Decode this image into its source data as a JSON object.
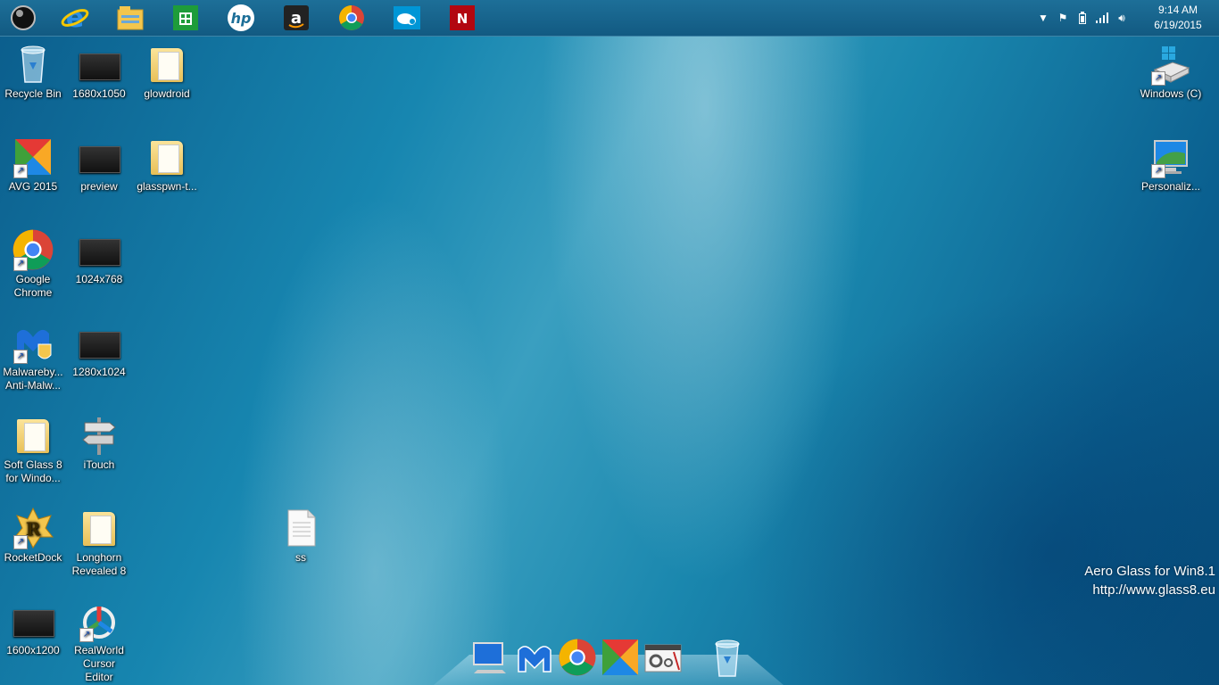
{
  "taskbar": {
    "pinned": [
      {
        "id": "start",
        "icon": "start-orb-icon",
        "color": "#111111"
      },
      {
        "id": "ie",
        "icon": "internet-explorer-icon",
        "color": "#1e88e5"
      },
      {
        "id": "explorer",
        "icon": "file-explorer-icon",
        "color": "#f3c64d"
      },
      {
        "id": "store",
        "icon": "windows-store-icon",
        "color": "#1e9c3a"
      },
      {
        "id": "hp",
        "icon": "hp-logo-icon",
        "color": "#0096d6",
        "text": "hp"
      },
      {
        "id": "amazon",
        "icon": "amazon-icon",
        "color": "#222222",
        "text": "a"
      },
      {
        "id": "chrome",
        "icon": "chrome-icon",
        "color": "#db4437"
      },
      {
        "id": "hp-connected",
        "icon": "hp-cloud-icon",
        "color": "#0096d6"
      },
      {
        "id": "netflix",
        "icon": "netflix-icon",
        "color": "#b20710",
        "text": "N"
      }
    ],
    "tray": {
      "icons": [
        "chevron-up-icon",
        "action-center-flag-icon",
        "battery-icon",
        "signal-bars-icon",
        "volume-icon"
      ],
      "time": "9:14 AM",
      "date": "6/19/2015"
    }
  },
  "desktop": {
    "recycle_bin": "Recycle Bin",
    "res_1680": "1680x1050",
    "glowdroid": "glowdroid",
    "avg": "AVG 2015",
    "preview": "preview",
    "glasspwn": "glasspwn-t...",
    "chrome_line1": "Google",
    "chrome_line2": "Chrome",
    "res_1024": "1024x768",
    "malware_line1": "Malwareby...",
    "malware_line2": "Anti-Malw...",
    "res_1280": "1280x1024",
    "softglass_line1": "Soft Glass 8",
    "softglass_line2": "for Windo...",
    "itouch": "iTouch",
    "rocketdock": "RocketDock",
    "longhorn_line1": "Longhorn",
    "longhorn_line2": "Revealed 8",
    "ss": "ss",
    "res_1600": "1600x1200",
    "realworld_line1": "RealWorld",
    "realworld_line2": "Cursor Editor",
    "windows_c": "Windows (C)",
    "personalize": "Personaliz..."
  },
  "watermark": {
    "line1": "Aero Glass for Win8.1",
    "line2": "http://www.glass8.eu"
  },
  "dock": {
    "items": [
      "computer-icon",
      "malwarebytes-icon",
      "chrome-icon",
      "avg-icon",
      "control-panel-icon",
      "recycle-bin-icon"
    ]
  }
}
